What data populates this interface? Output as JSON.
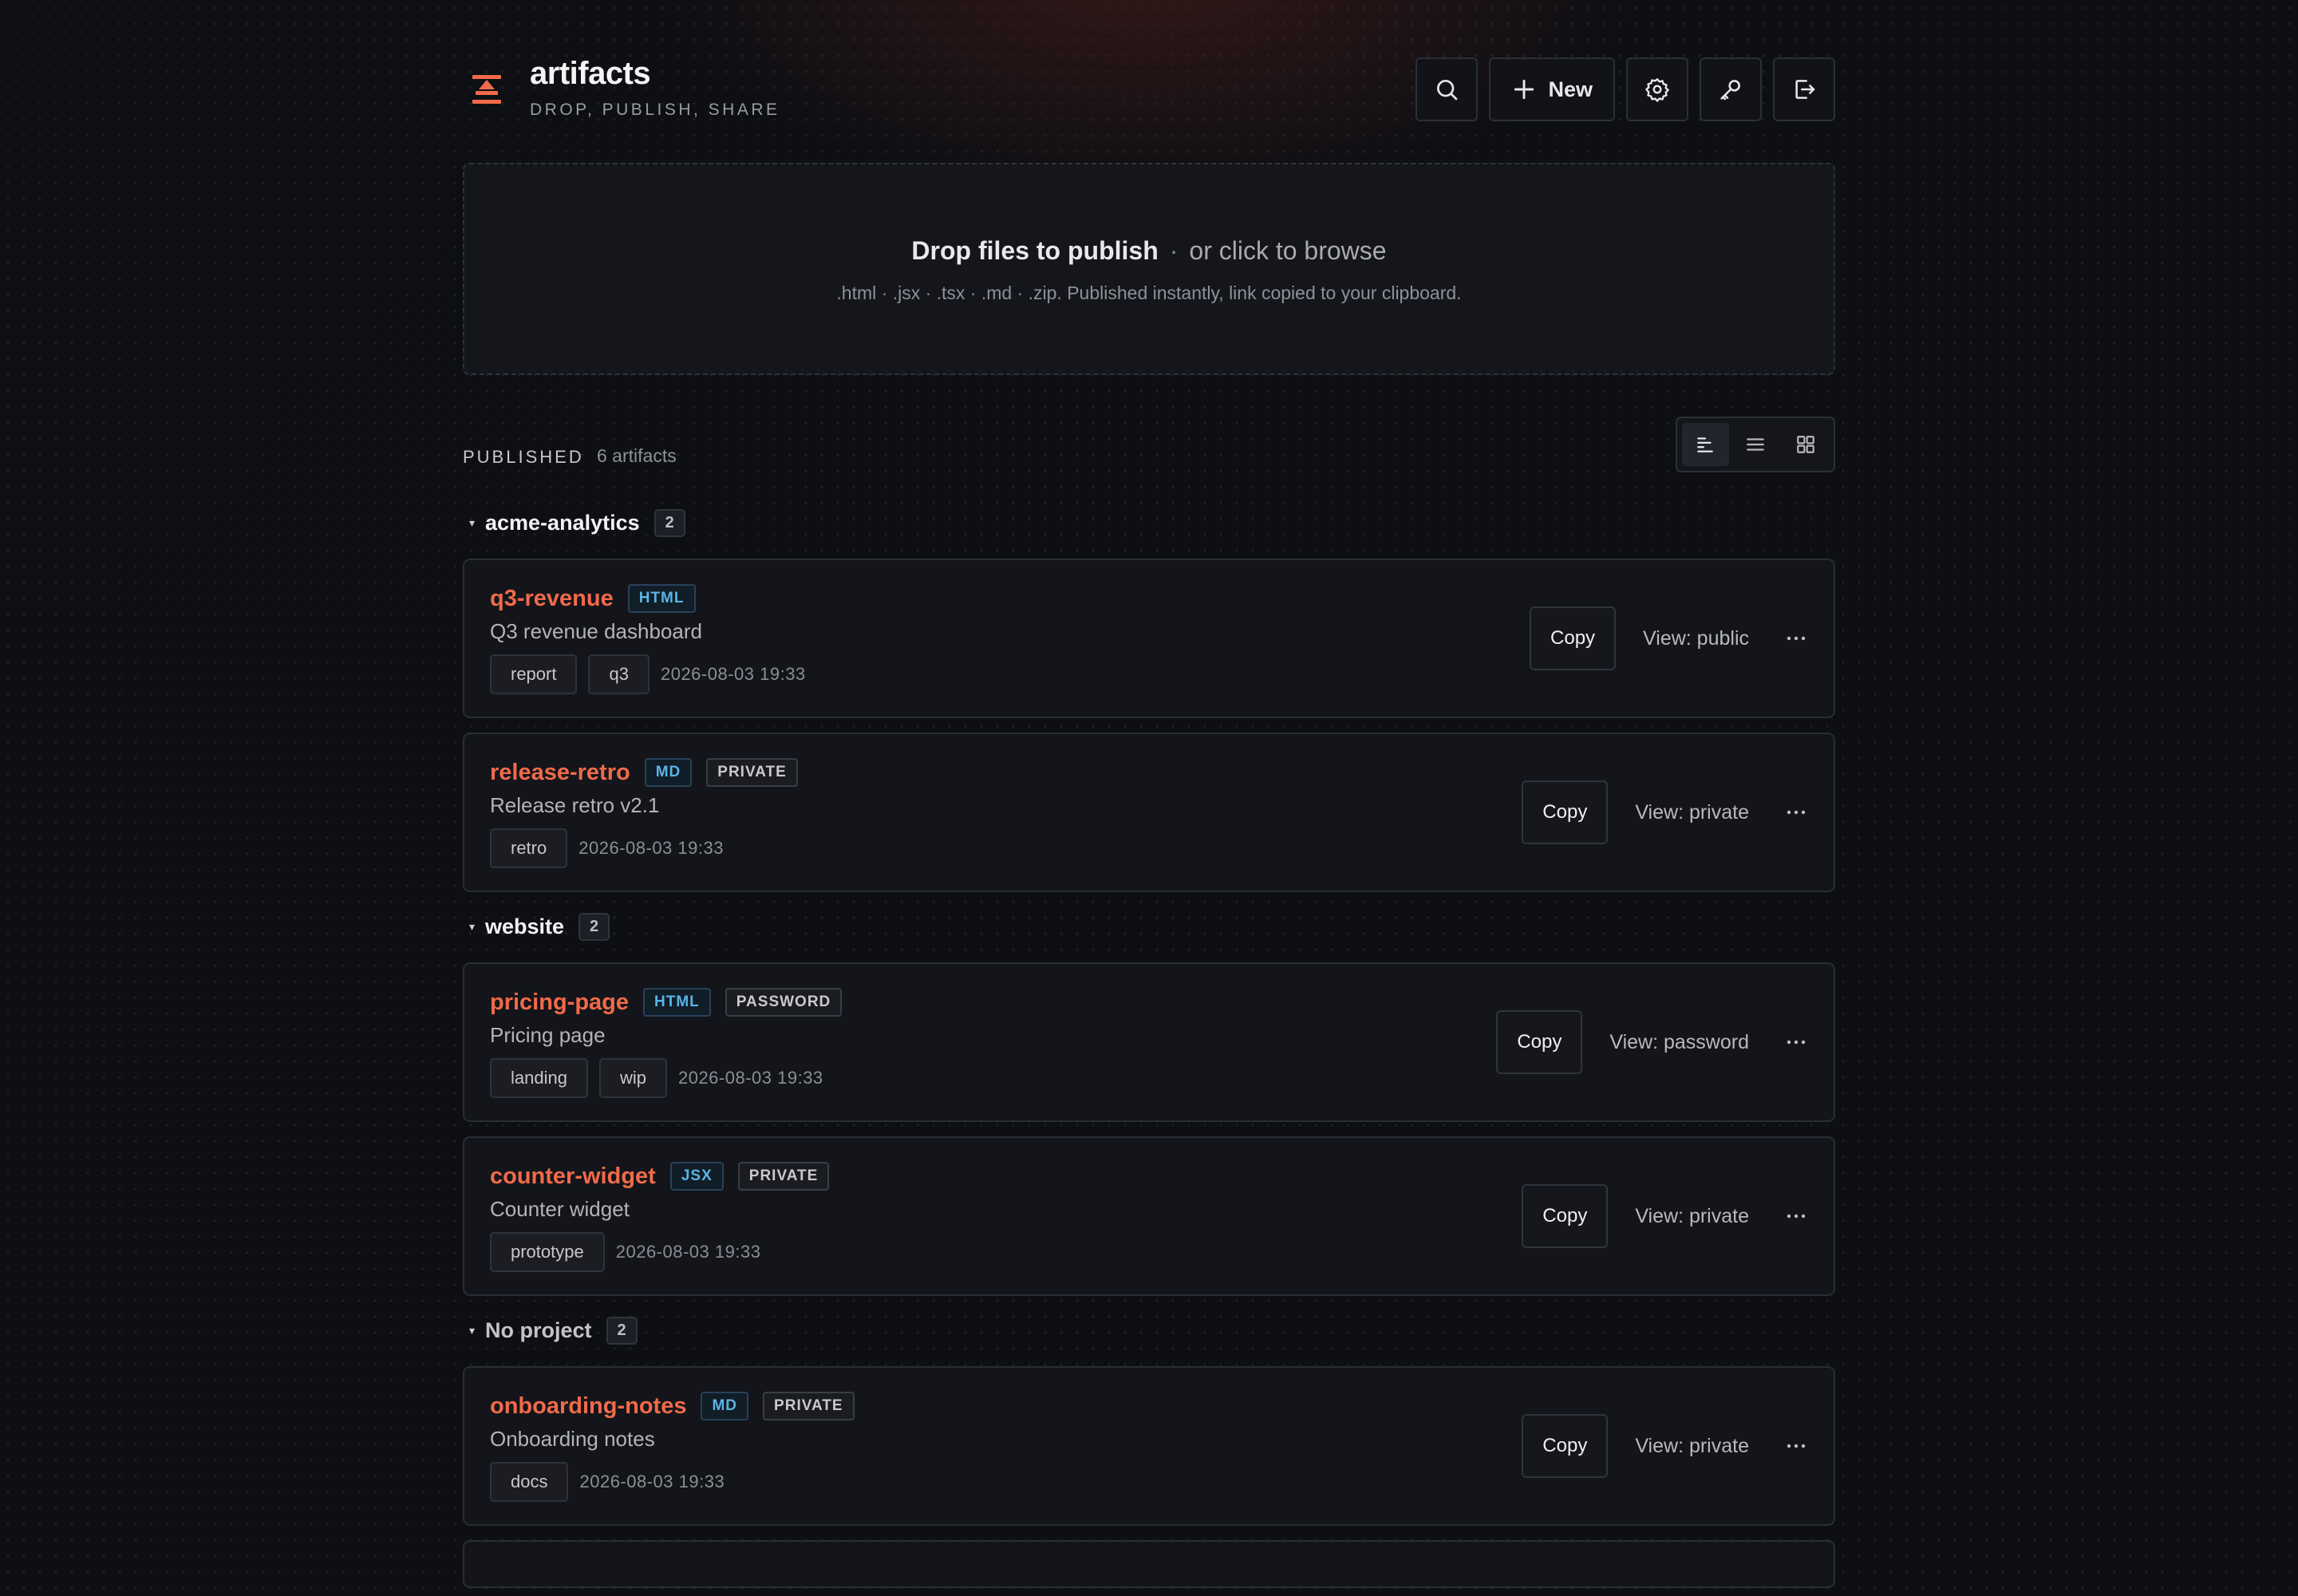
{
  "app": {
    "title": "artifacts",
    "subtitle": "DROP, PUBLISH, SHARE",
    "logo_icon": "stack-logo-icon",
    "accent": "#f06a4a"
  },
  "toolbar": {
    "new_label": "New",
    "icons": [
      "search-icon",
      "plus-icon",
      "gear-icon",
      "key-icon",
      "logout-icon"
    ]
  },
  "dropzone": {
    "title": "Drop files to publish",
    "separator": "·",
    "browse": "or click to browse",
    "hint": ".html · .jsx · .tsx · .md · .zip. Published instantly, link copied to your clipboard."
  },
  "published": {
    "label": "PUBLISHED",
    "count": "6 artifacts",
    "view_modes": [
      "grouped",
      "list",
      "grid"
    ],
    "active_view": "grouped"
  },
  "groups": [
    {
      "name": "acme-analytics",
      "count": "2",
      "items": [
        {
          "name": "q3-revenue",
          "type": "HTML",
          "visibility": "",
          "desc": "Q3 revenue dashboard",
          "tags": [
            "report",
            "q3"
          ],
          "time": "2026-08-03 19:33",
          "copy": "Copy",
          "view": "View: public"
        },
        {
          "name": "release-retro",
          "type": "MD",
          "visibility": "PRIVATE",
          "desc": "Release retro v2.1",
          "tags": [
            "retro"
          ],
          "time": "2026-08-03 19:33",
          "copy": "Copy",
          "view": "View: private"
        }
      ]
    },
    {
      "name": "website",
      "count": "2",
      "items": [
        {
          "name": "pricing-page",
          "type": "HTML",
          "visibility": "PASSWORD",
          "desc": "Pricing page",
          "tags": [
            "landing",
            "wip"
          ],
          "time": "2026-08-03 19:33",
          "copy": "Copy",
          "view": "View: password"
        },
        {
          "name": "counter-widget",
          "type": "JSX",
          "visibility": "PRIVATE",
          "desc": "Counter widget",
          "tags": [
            "prototype"
          ],
          "time": "2026-08-03 19:33",
          "copy": "Copy",
          "view": "View: private"
        }
      ]
    },
    {
      "name": "No project",
      "count": "2",
      "items": [
        {
          "name": "onboarding-notes",
          "type": "MD",
          "visibility": "PRIVATE",
          "desc": "Onboarding notes",
          "tags": [
            "docs"
          ],
          "time": "2026-08-03 19:33",
          "copy": "Copy",
          "view": "View: private"
        }
      ]
    }
  ]
}
